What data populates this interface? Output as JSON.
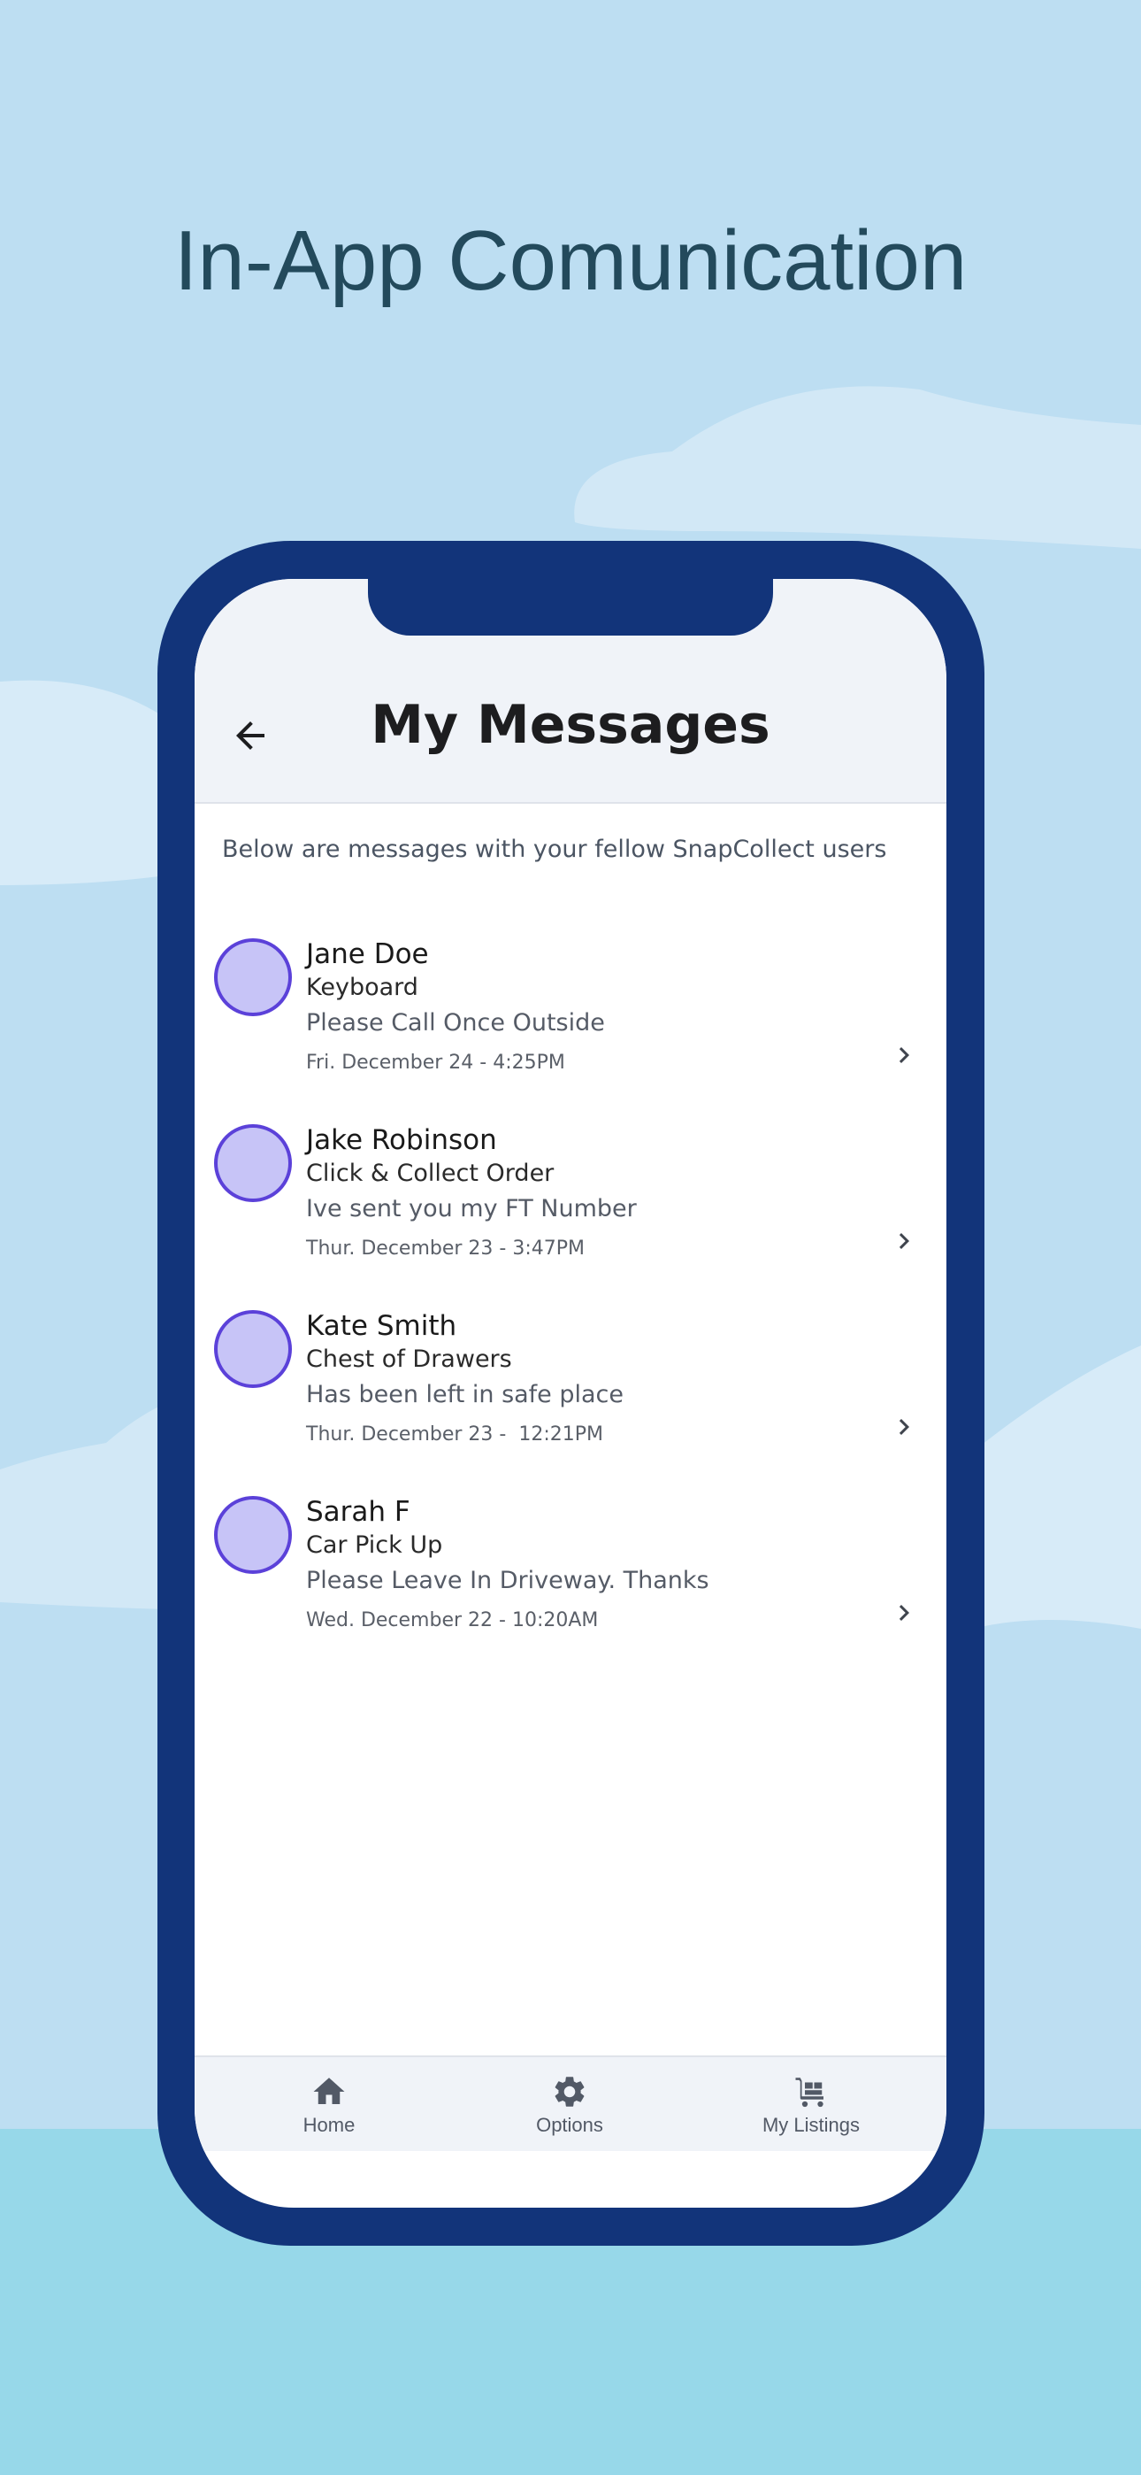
{
  "headline": "In-App Comunication",
  "colors": {
    "sky": "#bddef2",
    "phone_frame": "#12347a",
    "avatar_fill": "#c7c4f7",
    "avatar_border": "#5b41d9",
    "header_bg": "#f0f3f8"
  },
  "header": {
    "back_icon": "arrow-left-icon",
    "title": "My Messages"
  },
  "intro": "Below are messages with your fellow SnapCollect users",
  "messages": [
    {
      "name": "Jane Doe",
      "subject": "Keyboard",
      "preview": "Please Call Once Outside",
      "time": "Fri. December 24 - 4:25PM"
    },
    {
      "name": "Jake Robinson",
      "subject": "Click & Collect Order",
      "preview": "Ive sent you my FT Number",
      "time": "Thur. December 23 - 3:47PM"
    },
    {
      "name": "Kate Smith",
      "subject": "Chest of Drawers",
      "preview": "Has been left in safe place",
      "time": "Thur. December 23 -  12:21PM"
    },
    {
      "name": "Sarah F",
      "subject": "Car Pick Up",
      "preview": "Please Leave In Driveway. Thanks",
      "time": "Wed. December 22 - 10:20AM"
    }
  ],
  "nav": {
    "home": {
      "label": "Home",
      "icon": "home-icon"
    },
    "options": {
      "label": "Options",
      "icon": "gear-icon"
    },
    "listings": {
      "label": "My Listings",
      "icon": "cart-icon"
    }
  }
}
